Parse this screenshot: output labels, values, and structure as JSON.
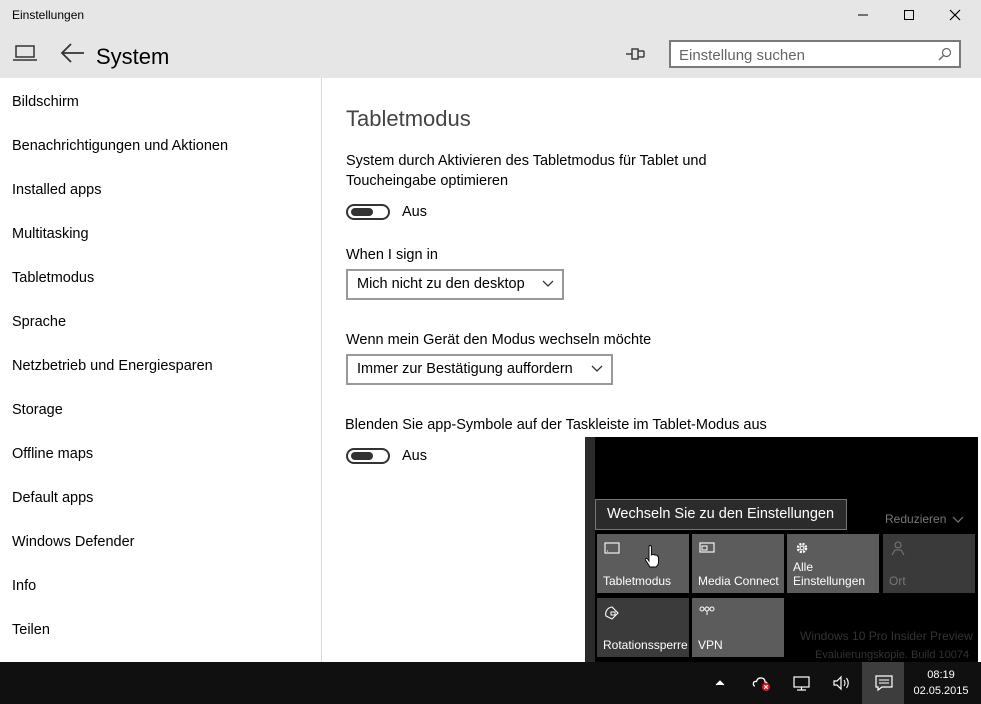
{
  "window": {
    "title": "Einstellungen",
    "page_title": "System"
  },
  "search": {
    "placeholder": "Einstellung suchen"
  },
  "sidebar": {
    "items": [
      {
        "label": "Bildschirm"
      },
      {
        "label": "Benachrichtigungen und Aktionen"
      },
      {
        "label": "Installed apps"
      },
      {
        "label": "Multitasking"
      },
      {
        "label": "Tabletmodus"
      },
      {
        "label": "Sprache"
      },
      {
        "label": "Netzbetrieb und Energiesparen"
      },
      {
        "label": "Storage"
      },
      {
        "label": "Offline maps"
      },
      {
        "label": "Default apps"
      },
      {
        "label": "Windows Defender"
      },
      {
        "label": "Info"
      },
      {
        "label": "Teilen"
      }
    ]
  },
  "content": {
    "section_title": "Tabletmodus",
    "tablet_desc": "System durch Aktivieren des Tabletmodus für Tablet und Toucheingabe optimieren",
    "tablet_toggle_state": "Aus",
    "signin_label": "When I sign in",
    "signin_value": "Mich nicht zu den desktop",
    "switch_label": "Wenn mein Gerät den Modus wechseln möchte",
    "switch_value": "Immer zur Bestätigung auffordern",
    "hide_icons_label": "Blenden Sie app-Symbole auf der Taskleiste im Tablet-Modus aus",
    "hide_icons_state": "Aus"
  },
  "action_center": {
    "tooltip": "Wechseln Sie zu den Einstellungen",
    "collapse_label": "Reduzieren",
    "tiles": [
      {
        "label": "Tabletmodus",
        "icon": "tablet-icon"
      },
      {
        "label": "Media Connect",
        "icon": "project-icon"
      },
      {
        "label": "Alle Einstellungen",
        "icon": "gear-icon"
      },
      {
        "label": "Ort",
        "icon": "location-icon"
      },
      {
        "label": "Rotationssperre",
        "icon": "rotation-lock-icon"
      },
      {
        "label": "VPN",
        "icon": "vpn-icon"
      }
    ],
    "watermark_line1": "Windows 10 Pro Insider Preview",
    "watermark_line2": "Evaluierungskopie. Build 10074"
  },
  "taskbar": {
    "time": "08:19",
    "date": "02.05.2015"
  }
}
